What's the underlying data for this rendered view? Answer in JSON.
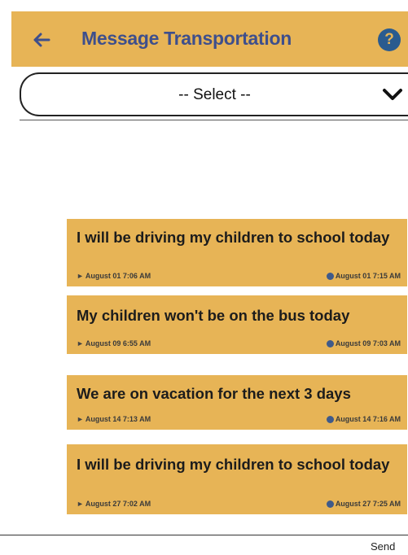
{
  "header": {
    "title": "Message Transportation",
    "back_icon": "back-arrow-icon",
    "help_icon": "help-icon",
    "help_glyph": "?",
    "background": "#e7b456",
    "title_color": "#3e4f8c"
  },
  "select": {
    "value": "-- Select --"
  },
  "messages": [
    {
      "text": "I will be driving my children to school today",
      "sent": "August 01 7:06 AM",
      "read": "August 01 7:15 AM"
    },
    {
      "text": "My children won't be on the bus today",
      "sent": "August 09 6:55 AM",
      "read": "August 09 7:03 AM"
    },
    {
      "text": "We are on vacation for the next 3 days",
      "sent": "August 14 7:13 AM",
      "read": "August 14 7:16 AM"
    },
    {
      "text": "I will be driving my children to school today",
      "sent": "August 27 7:02 AM",
      "read": "August 27 7:25 AM"
    }
  ],
  "compose": {
    "send_label": "Send"
  }
}
